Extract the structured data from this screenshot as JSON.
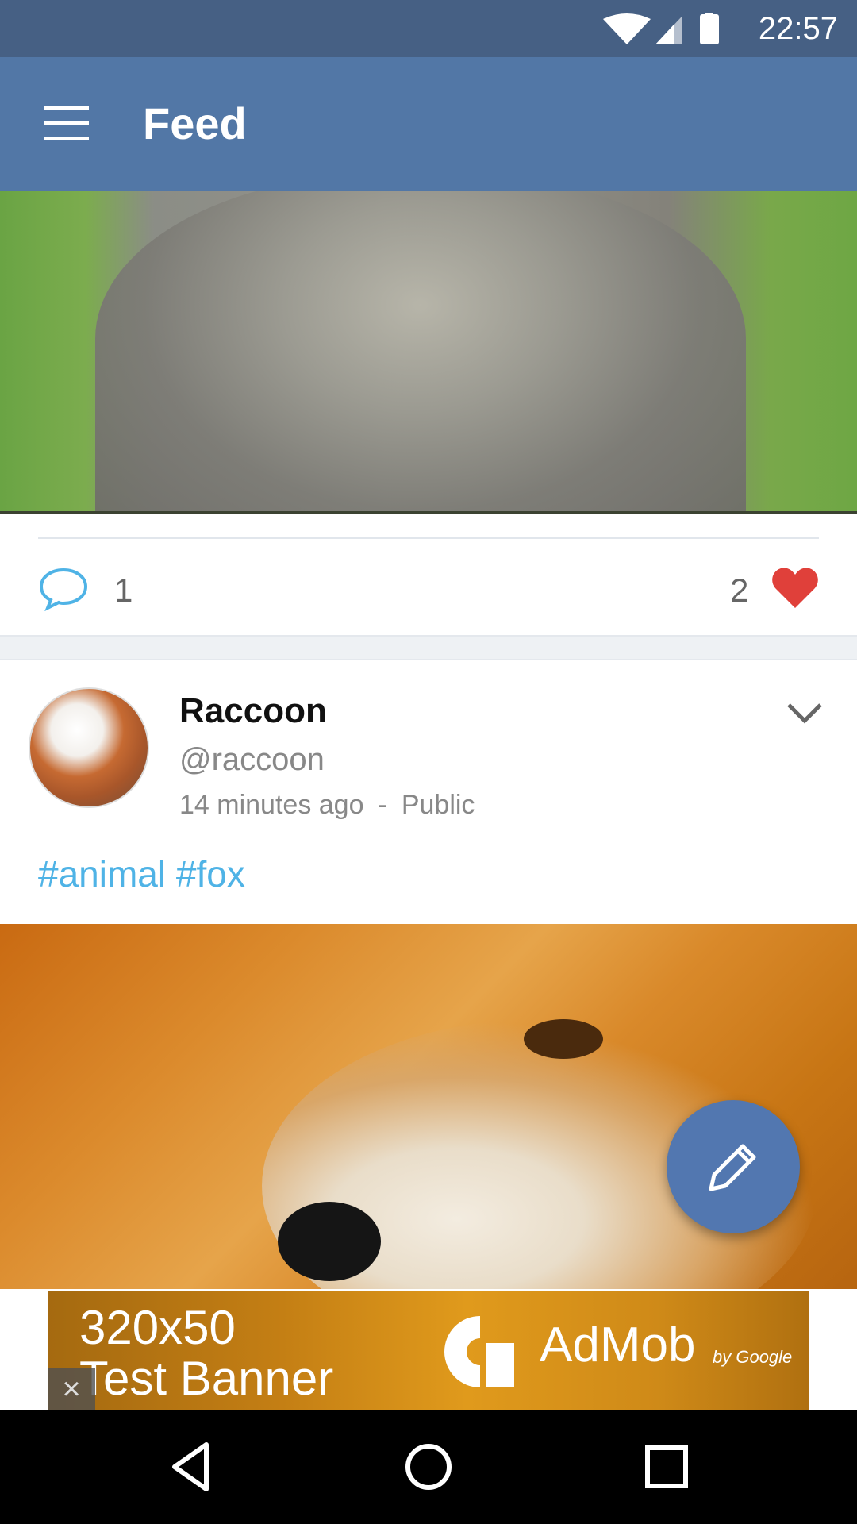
{
  "status_bar": {
    "time": "22:57",
    "icons": [
      "wifi-icon",
      "signal-icon",
      "battery-icon"
    ]
  },
  "app_bar": {
    "title": "Feed"
  },
  "post_previous": {
    "comment_count": "1",
    "like_count": "2"
  },
  "post": {
    "author_name": "Raccoon",
    "author_handle": "@raccoon",
    "timestamp": "14 minutes ago",
    "separator": "-",
    "visibility": "Public",
    "hashtags": [
      "#animal",
      "#fox"
    ]
  },
  "ad_banner": {
    "line1": "320x50",
    "line2": "Test Banner",
    "brand": "AdMob",
    "brand_sub": "by Google",
    "close": "×"
  },
  "colors": {
    "status_bar": "#466084",
    "app_bar": "#5277a6",
    "fab": "#5277b0",
    "hashtag": "#4fb3e6",
    "heart": "#e0403a",
    "comment_icon": "#4fb3e6"
  }
}
